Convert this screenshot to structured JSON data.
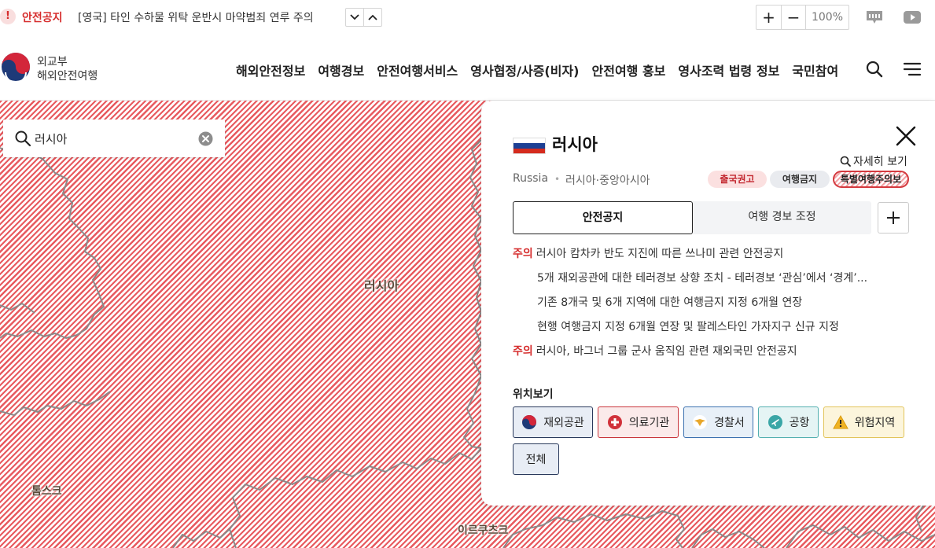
{
  "notice_bar": {
    "alert_symbol": "!",
    "label": "안전공지",
    "text": "[영국] 타인 수하물 위탁 운반시 마약범죄 연루 주의",
    "zoom_in": "+",
    "zoom_out": "−",
    "zoom_level": "100%"
  },
  "logo": {
    "line1": "외교부",
    "line2": "해외안전여행"
  },
  "nav": {
    "items": [
      "해외안전정보",
      "여행경보",
      "안전여행서비스",
      "영사협정/사증(비자)",
      "안전여행 홍보",
      "영사조력 법령 정보",
      "국민참여"
    ]
  },
  "map": {
    "labels": {
      "russia": "러시아",
      "tomsk": "톰스크",
      "irkutsk": "이르쿠츠크"
    },
    "hatch_color": "#e85a5f",
    "border_color": "#8a8a8a"
  },
  "search": {
    "value": "러시아"
  },
  "panel": {
    "country_name": "러시아",
    "country_en": "Russia",
    "separator": "•",
    "region": "러시아·중앙아시아",
    "detail_link": "자세히 보기",
    "badges": [
      "출국권고",
      "여행금지",
      "특별여행주의보"
    ],
    "tabs": [
      "안전공지",
      "여행 경보 조정"
    ],
    "notices": [
      {
        "tag": "주의",
        "text": "러시아 캄차카 반도 지진에 따른 쓰나미 관련 안전공지"
      },
      {
        "tag": "",
        "text": "5개 재외공관에 대한 테러경보 상향 조치 - 테러경보 ‘관심’에서 ‘경계’..."
      },
      {
        "tag": "",
        "text": "기존 8개국 및 6개 지역에 대한 여행금지 지정 6개월 연장"
      },
      {
        "tag": "",
        "text": "현행 여행금지 지정 6개월 연장 및 팔레스타인 가자지구 신규 지정"
      },
      {
        "tag": "주의",
        "text": "러시아, 바그너 그룹 군사 움직임 관련 재외국민 안전공지"
      }
    ],
    "location_title": "위치보기",
    "location_buttons": {
      "embassy": "재외공관",
      "medical": "의료기관",
      "police": "경찰서",
      "airport": "공항",
      "danger": "위험지역",
      "all": "전체"
    },
    "flag_colors": [
      "#ffffff",
      "#1c3f94",
      "#d52b1e"
    ]
  }
}
